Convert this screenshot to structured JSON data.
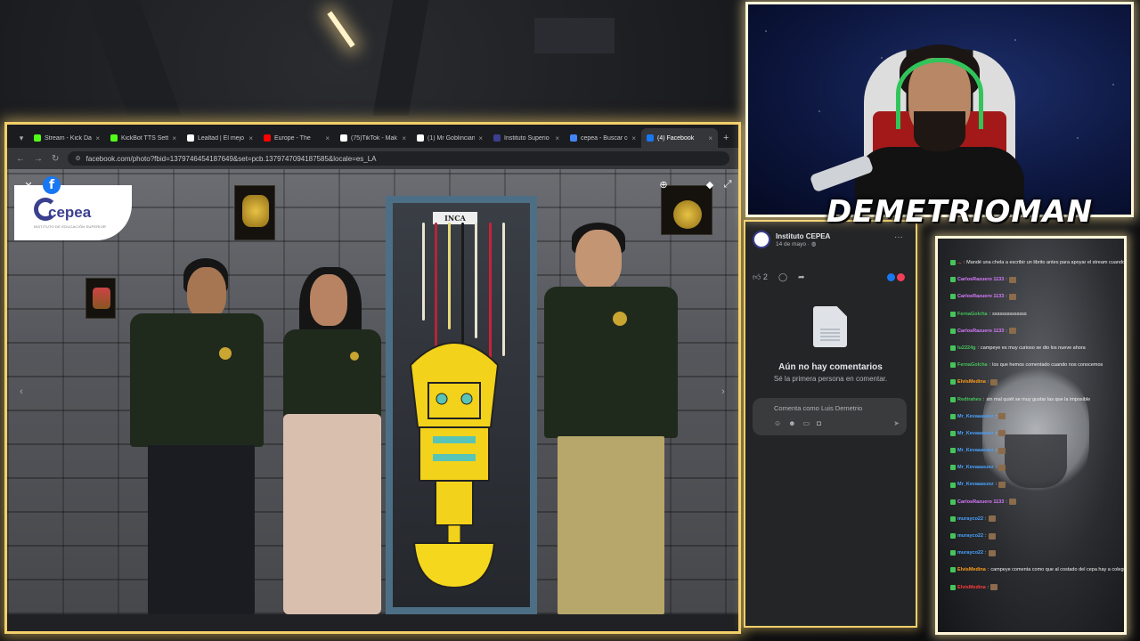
{
  "browser": {
    "tabs": [
      {
        "label": "Stream - Kick Da",
        "fav": "#53fc18",
        "active": false
      },
      {
        "label": "KickBot TTS Setti",
        "fav": "#53fc18",
        "active": false
      },
      {
        "label": "Lealtad | El mejo",
        "fav": "#ffffff",
        "active": false
      },
      {
        "label": "Europe - The",
        "fav": "#ff0000",
        "active": false
      },
      {
        "label": "(75)TikTok - Mak",
        "fav": "#ffffff",
        "active": false
      },
      {
        "label": "(1) Mr Goblincian",
        "fav": "#ffffff",
        "active": false
      },
      {
        "label": "Instituto Superio",
        "fav": "#3b3f8f",
        "active": false
      },
      {
        "label": "cepea - Buscar co",
        "fav": "#4285f4",
        "active": false
      },
      {
        "label": "(4) Facebook",
        "fav": "#1877f2",
        "active": true
      }
    ],
    "new_tab": "+",
    "url": "facebook.com/photo?fbid=1379746454187649&set=pcb.1379747094187585&locale=es_LA"
  },
  "photo": {
    "sign": "INCA",
    "logo_word": "cepea",
    "logo_sub": "INSTITUTO DE EDUCACIÓN SUPERIOR"
  },
  "post": {
    "author": "Instituto CEPEA",
    "date": "14 de mayo · ",
    "likes": "2",
    "no_comments_title": "Aún no hay comentarios",
    "no_comments_sub": "Sé la primera persona en comentar.",
    "comment_placeholder": "Comenta como Luis Demetrio"
  },
  "stream": {
    "streamer_name": "DEMETRIOMAN"
  },
  "chat": {
    "messages": [
      {
        "user": "...",
        "color": "#ff6a3d",
        "text": "Mandé una chela a escribir un librito antes para apoyar el stream cuando vaya este mensaje"
      },
      {
        "user": "CarlosRazuero 1133",
        "color": "#d97bff",
        "text": ""
      },
      {
        "user": "CarlosRazuero 1133",
        "color": "#d97bff",
        "text": ""
      },
      {
        "user": "FernaGolcha",
        "color": "#46c35a",
        "text": "ssssssssssssss"
      },
      {
        "user": "CarlosRazuero 1133",
        "color": "#d97bff",
        "text": ""
      },
      {
        "user": "lu2224g",
        "color": "#46c35a",
        "text": "campeye es muy curioso se dio los nueve ahora"
      },
      {
        "user": "FernaGolcha",
        "color": "#46c35a",
        "text": "los que hemos comentado cuando nos conocemos"
      },
      {
        "user": "ElvisMedina",
        "color": "#ff9f1c",
        "text": ""
      },
      {
        "user": "Redtrahes",
        "color": "#46c35a",
        "text": "sin mal quiét se muy gustar las que la imposible"
      },
      {
        "user": "Mr_Kevaaaszez",
        "color": "#4aa3ff",
        "text": ""
      },
      {
        "user": "Mr_Kevaaaszez",
        "color": "#4aa3ff",
        "text": ""
      },
      {
        "user": "Mr_Kevaaaszez",
        "color": "#4aa3ff",
        "text": ""
      },
      {
        "user": "Mr_Kevaaaszez",
        "color": "#4aa3ff",
        "text": ""
      },
      {
        "user": "Mr_Kevaaaszez",
        "color": "#4aa3ff",
        "text": ""
      },
      {
        "user": "CarlosRazuero 1133",
        "color": "#d97bff",
        "text": ""
      },
      {
        "user": "murayco22",
        "color": "#4aa3ff",
        "text": ""
      },
      {
        "user": "murayco22",
        "color": "#4aa3ff",
        "text": ""
      },
      {
        "user": "murayco22",
        "color": "#4aa3ff",
        "text": ""
      },
      {
        "user": "ElvisMedina",
        "color": "#ff9f1c",
        "text": "campeye comenta como que al costado del cepa hay a colegio? muuuucho mucccccooo"
      },
      {
        "user": "ElvisMedina",
        "color": "#ff3b3b",
        "text": ""
      }
    ]
  }
}
